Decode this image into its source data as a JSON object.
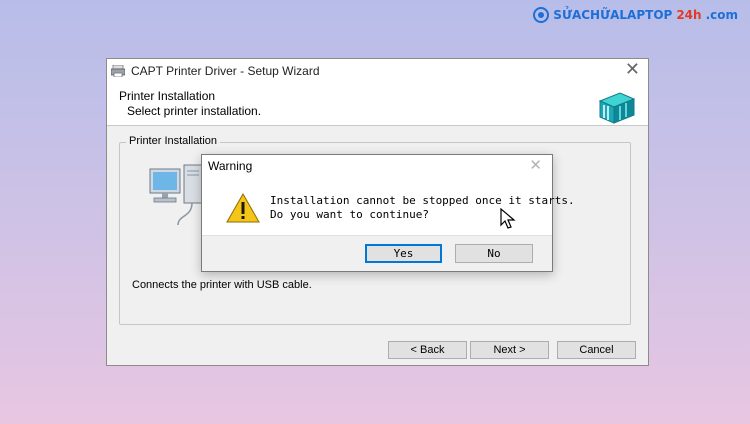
{
  "brand": {
    "part1": "SỬACHỮALAPTOP",
    "part2": "24h",
    "part3": ".com"
  },
  "wizard": {
    "title": "CAPT Printer Driver - Setup Wizard",
    "close_symbol": "✕",
    "header_title": "Printer Installation",
    "header_subtitle": "Select printer installation.",
    "group_label": "Printer Installation",
    "usb_description": "Connects the printer with USB cable.",
    "buttons": {
      "back": "< Back",
      "next": "Next >",
      "cancel": "Cancel"
    }
  },
  "dialog": {
    "title": "Warning",
    "close_symbol": "✕",
    "icon": "warning-icon",
    "message_line1": "Installation cannot be stopped once it starts.",
    "message_line2": "Do you want to continue?",
    "yes": "Yes",
    "no": "No"
  },
  "colors": {
    "focus_border": "#0078d7",
    "warning_yellow": "#f5c518"
  }
}
